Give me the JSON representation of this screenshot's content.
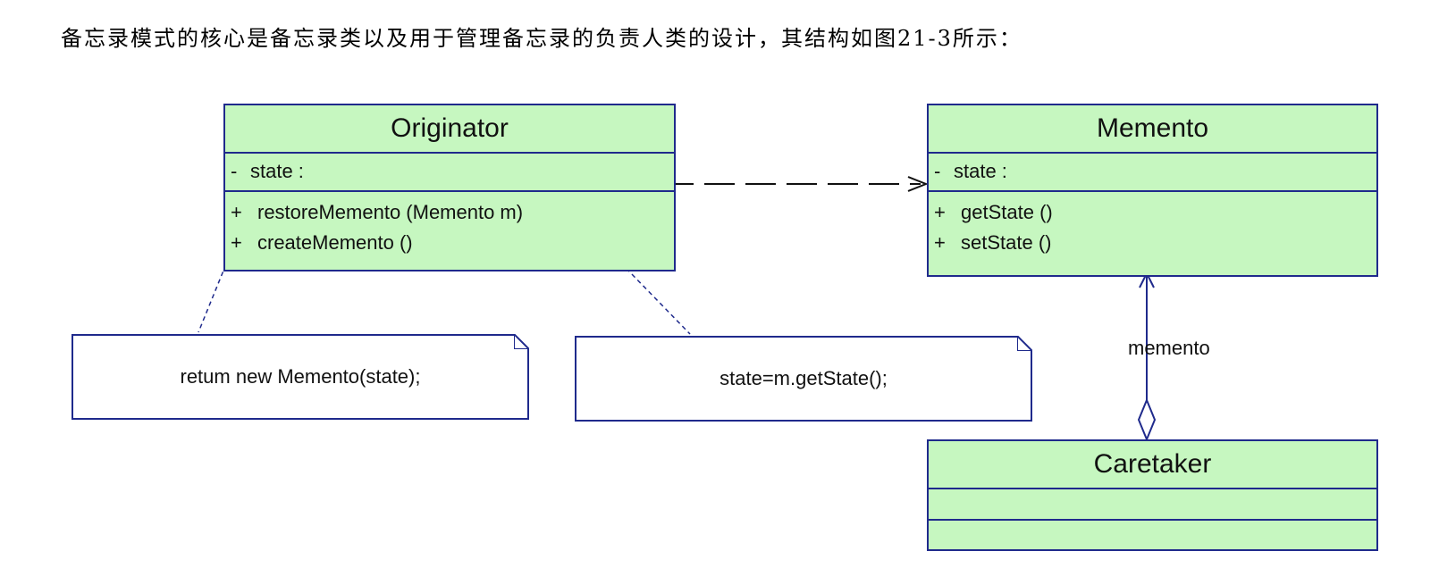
{
  "intro_text": "备忘录模式的核心是备忘录类以及用于管理备忘录的负责人类的设计，其结构如图21-3所示：",
  "diagram": {
    "classes": {
      "originator": {
        "name": "Originator",
        "attributes": [
          {
            "visibility": "-",
            "text": "state :"
          }
        ],
        "operations": [
          {
            "visibility": "+",
            "text": "restoreMemento (Memento m)"
          },
          {
            "visibility": "+",
            "text": "createMemento ()"
          }
        ]
      },
      "memento": {
        "name": "Memento",
        "attributes": [
          {
            "visibility": "-",
            "text": "state :"
          }
        ],
        "operations": [
          {
            "visibility": "+",
            "text": "getState ()"
          },
          {
            "visibility": "+",
            "text": "setState ()"
          }
        ]
      },
      "caretaker": {
        "name": "Caretaker",
        "attributes": [],
        "operations": []
      }
    },
    "notes": {
      "create_memento": {
        "text": "retum new Memento(state);"
      },
      "restore_memento": {
        "text": "state=m.getState();"
      }
    },
    "relationships": {
      "originator_to_memento": {
        "type": "dependency"
      },
      "caretaker_to_memento": {
        "type": "aggregation",
        "role": "memento"
      }
    },
    "colors": {
      "class_fill": "#c6f7c0",
      "border": "#1f2a8c",
      "note_fill": "#ffffff"
    }
  }
}
